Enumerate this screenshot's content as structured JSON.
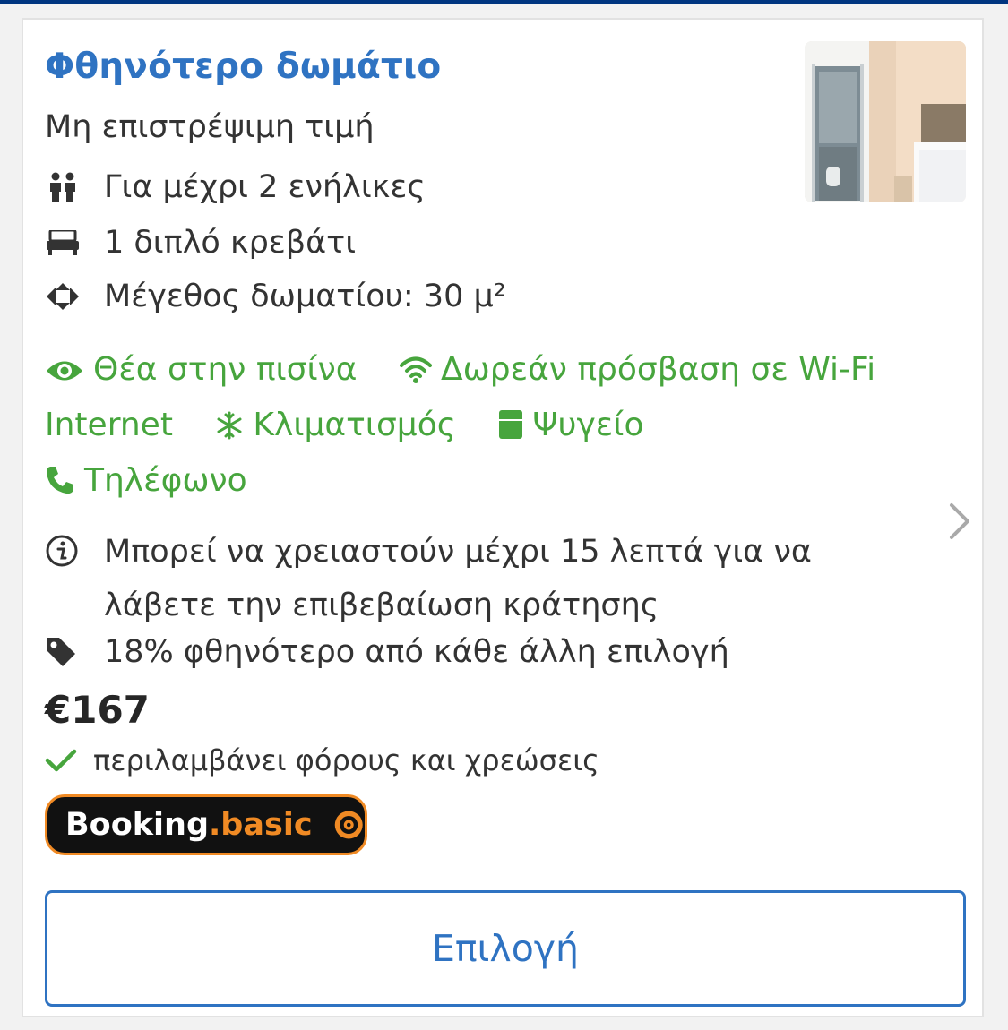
{
  "room": {
    "title": "Φθηνότερο δωμάτιο",
    "subtitle": "Μη επιστρέψιμη τιμή",
    "features": [
      {
        "icon": "guests-icon",
        "text": "Για μέχρι 2 ενήλικες"
      },
      {
        "icon": "bed-icon",
        "text": "1 διπλό κρεβάτι"
      },
      {
        "icon": "room-size-icon",
        "text": "Μέγεθος δωματίου: 30 μ²"
      }
    ]
  },
  "amenities": [
    {
      "icon": "eye-icon",
      "text": "Θέα στην πισίνα"
    },
    {
      "icon": "wifi-icon",
      "text": "Δωρεάν πρόσβαση σε Wi-Fi Internet"
    },
    {
      "icon": "snowflake-icon",
      "text": "Κλιματισμός"
    },
    {
      "icon": "fridge-icon",
      "text": "Ψυγείο"
    },
    {
      "icon": "phone-icon",
      "text": "Τηλέφωνο"
    }
  ],
  "info": {
    "icon": "info-icon",
    "text": "Μπορεί να χρειαστούν μέχρι 15 λεπτά για να λάβετε την επιβεβαίωση κράτησης"
  },
  "deal": {
    "icon": "tag-icon",
    "text": "18% φθηνότερο από κάθε άλλη επιλογή"
  },
  "price": {
    "amount": "€167",
    "tax_note": "περιλαμβάνει φόρους και χρεώσεις"
  },
  "badge": {
    "part1": "Booking",
    "part2": ".basic"
  },
  "select_button": "Επιλογή",
  "colors": {
    "brand_blue": "#2f73c2",
    "amenity_green": "#47a53d",
    "badge_orange": "#f08a24",
    "top_bar": "#003580"
  }
}
